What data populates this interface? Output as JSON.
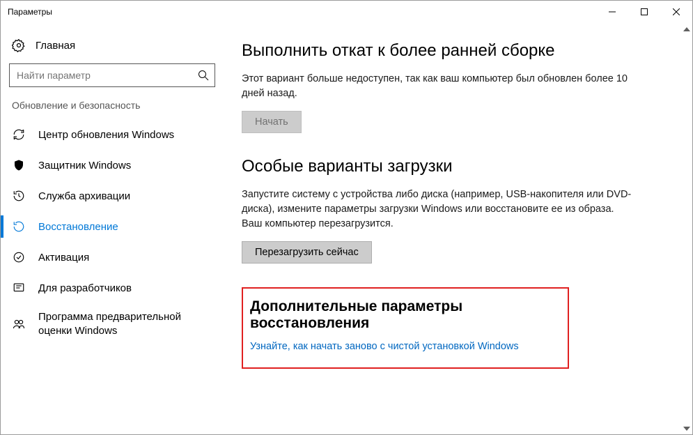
{
  "window": {
    "title": "Параметры"
  },
  "sidebar": {
    "home": "Главная",
    "search_placeholder": "Найти параметр",
    "group_header": "Обновление и безопасность",
    "items": [
      {
        "label": "Центр обновления Windows"
      },
      {
        "label": "Защитник Windows"
      },
      {
        "label": "Служба архивации"
      },
      {
        "label": "Восстановление"
      },
      {
        "label": "Активация"
      },
      {
        "label": "Для разработчиков"
      },
      {
        "label": "Программа предварительной оценки Windows"
      }
    ]
  },
  "main": {
    "section1": {
      "heading": "Выполнить откат к более ранней сборке",
      "body": "Этот вариант больше недоступен, так как ваш компьютер был обновлен более 10 дней назад.",
      "button": "Начать"
    },
    "section2": {
      "heading": "Особые варианты загрузки",
      "body": "Запустите систему с устройства либо диска (например, USB-накопителя или DVD-диска), измените параметры загрузки Windows или восстановите ее из образа. Ваш компьютер перезагрузится.",
      "button": "Перезагрузить сейчас"
    },
    "section3": {
      "heading": "Дополнительные параметры восстановления",
      "link": "Узнайте, как начать заново с чистой установкой Windows"
    }
  }
}
